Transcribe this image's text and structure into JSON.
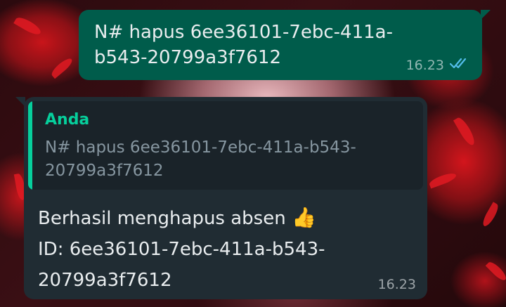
{
  "outgoing": {
    "text": "N# hapus 6ee36101-7ebc-411a-b543-20799a3f7612",
    "time": "16.23",
    "status_icon": "double-check-read-icon"
  },
  "incoming": {
    "quote": {
      "author": "Anda",
      "text": "N# hapus 6ee36101-7ebc-411a-b543-20799a3f7612"
    },
    "line1": "Berhasil menghapus absen",
    "emoji": "👍",
    "line2": "ID: 6ee36101-7ebc-411a-b543-20799a3f7612",
    "time": "16.23"
  },
  "colors": {
    "outgoing_bubble": "#005c4b",
    "incoming_bubble": "#202c33",
    "quote_accent": "#06cf9c",
    "read_ticks": "#53bdeb",
    "wallpaper_red": "#d3151c"
  }
}
